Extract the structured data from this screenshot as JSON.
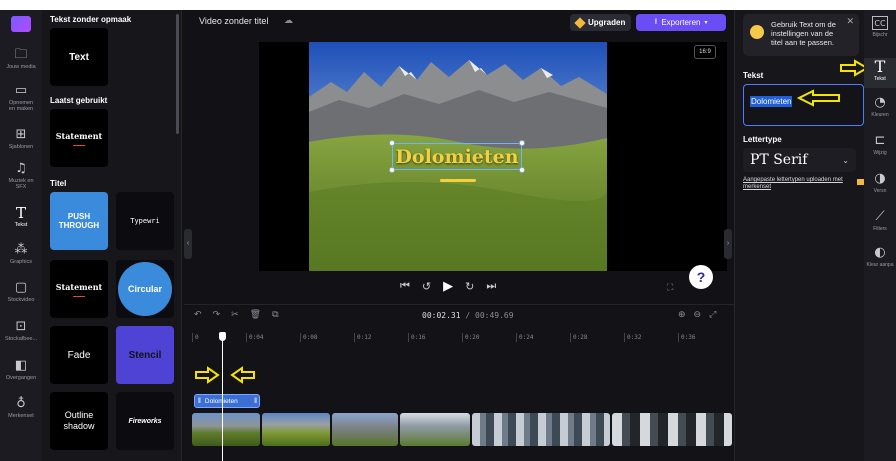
{
  "left_rail": {
    "items": [
      {
        "icon": "folder-icon",
        "glyph": "🗀",
        "label": "Jouw media"
      },
      {
        "icon": "camera-icon",
        "glyph": "▭",
        "label": "Opnemen\nen maken"
      },
      {
        "icon": "templates-icon",
        "glyph": "⊞",
        "label": "Sjablonen"
      },
      {
        "icon": "music-icon",
        "glyph": "♫",
        "label": "Muziek en\nSFX"
      },
      {
        "icon": "text-icon",
        "glyph": "T",
        "label": "Tekst"
      },
      {
        "icon": "graphics-icon",
        "glyph": "⁂",
        "label": "Graphics"
      },
      {
        "icon": "stock-video-icon",
        "glyph": "▢",
        "label": "Stockvideo"
      },
      {
        "icon": "stock-image-icon",
        "glyph": "⊡",
        "label": "Stockafbee..."
      },
      {
        "icon": "transitions-icon",
        "glyph": "◧",
        "label": "Overgangen"
      },
      {
        "icon": "brand-kit-icon",
        "glyph": "♁",
        "label": "Merkenset"
      }
    ]
  },
  "library": {
    "section_plain": "Tekst zonder opmaak",
    "plain_card": "Text",
    "section_recent": "Laatst gebruikt",
    "recent_card": "Statement",
    "section_titles": "Titel",
    "cards": [
      {
        "label": "PUSH THROUGH"
      },
      {
        "label": "Typewri"
      },
      {
        "label": "Statement"
      },
      {
        "label": "Circular"
      },
      {
        "label": "Fade"
      },
      {
        "label": "Stencil"
      },
      {
        "label": "Outline\nshadow"
      },
      {
        "label": "Fireworks"
      }
    ]
  },
  "topbar": {
    "project_title": "Video zonder titel",
    "upgrade_label": "Upgraden",
    "export_label": "Exporteren",
    "aspect_ratio": "16:9"
  },
  "preview": {
    "overlay_text": "Dolomieten"
  },
  "timeline": {
    "current_time": "00:02.31",
    "total_time": "00:49.69",
    "ruler": [
      "0",
      "0:04",
      "0:08",
      "0:12",
      "0:16",
      "0:20",
      "0:24",
      "0:28",
      "0:32",
      "0:36"
    ],
    "text_clip_label": "Dolomieten"
  },
  "properties": {
    "tip": "Gebruik Text om de instellingen van de titel aan te passen.",
    "text_label": "Tekst",
    "text_value": "Dolomieten",
    "font_label": "Lettertype",
    "font_value": "PT Serif",
    "upload_link": "Aangepaste lettertypen uploaden met merkenset"
  },
  "right_rail": {
    "items": [
      {
        "icon": "captions-icon",
        "glyph": "CC",
        "label": "Bijschr"
      },
      {
        "icon": "text-icon",
        "glyph": "T",
        "label": "Tekst"
      },
      {
        "icon": "color-icon",
        "glyph": "◔",
        "label": "Kleuren"
      },
      {
        "icon": "fade-icon",
        "glyph": "⊏",
        "label": "Wijzig"
      },
      {
        "icon": "speed-icon",
        "glyph": "◑",
        "label": "Versn"
      },
      {
        "icon": "filters-icon",
        "glyph": "⟋",
        "label": "Filters"
      },
      {
        "icon": "adjust-icon",
        "glyph": "◐",
        "label": "Kleur aanpa"
      }
    ]
  },
  "colors": {
    "accent": "#6a4df5",
    "annotation_arrow": "#f4e400",
    "title_text": "#f4d03f",
    "selection": "#1f5fd9"
  }
}
